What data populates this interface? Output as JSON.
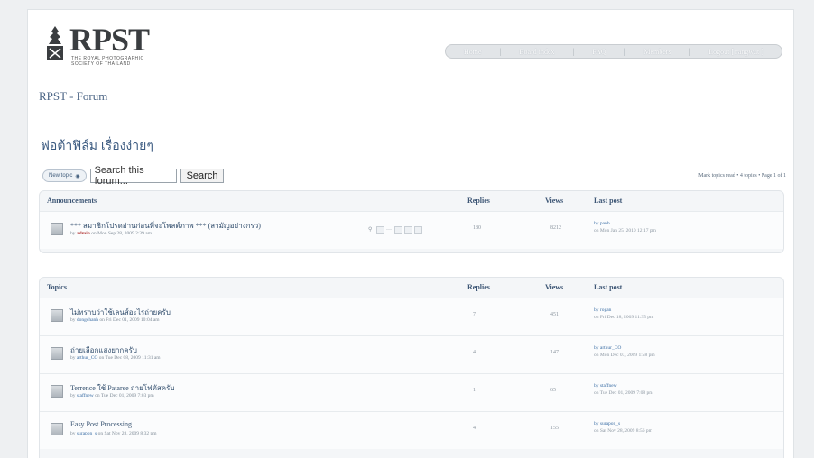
{
  "header": {
    "logo_word": "RPST",
    "logo_sub1": "THE ROYAL PHOTOGRAPHIC",
    "logo_sub2": "SOCIETY OF THAILAND",
    "site_title": "RPST - Forum"
  },
  "nav": {
    "items": [
      {
        "label": "Home"
      },
      {
        "label": "Board index"
      },
      {
        "label": "FAQ"
      },
      {
        "label": "Members"
      },
      {
        "label": "Logout [ rangwut ]"
      }
    ]
  },
  "forum": {
    "title": "ฟอต้าฟิล์ม เรื่องง่ายๆ"
  },
  "actions": {
    "new_topic": "New topic",
    "search_placeholder": "Search this forum...",
    "search_button": "Search",
    "pagination": "Mark topics read • 4 topics • Page 1 of 1"
  },
  "announcements": {
    "headers": {
      "title": "Announcements",
      "replies": "Replies",
      "views": "Views",
      "last_post": "Last post"
    },
    "rows": [
      {
        "title": "*** สมาชิกโปรดอ่านก่อนที่จะโพสต์ภาพ *** (สามัญอย่างกรว)",
        "meta_prefix": "by",
        "author": "admin",
        "meta_date": "on Mon Sep 28, 2009 2:39 am",
        "replies": "180",
        "views": "8212",
        "last_by": "by panb",
        "last_date": "on Mon Jan 25, 2010 12:17 pm"
      }
    ]
  },
  "topics": {
    "headers": {
      "title": "Topics",
      "replies": "Replies",
      "views": "Views",
      "last_post": "Last post"
    },
    "rows": [
      {
        "title": "ไม่ทราบว่าใช้เลนส์อะไรถ่ายครับ",
        "meta_prefix": "by",
        "author": "dongchanh",
        "meta_date": "on Fri Dec 01, 2009 10:04 am",
        "replies": "7",
        "views": "451",
        "last_by": "by rogan",
        "last_date": "on Fri Dec 18, 2009 11:35 pm"
      },
      {
        "title": "ถ่ายเลือกแสงยากครับ",
        "meta_prefix": "by",
        "author": "arthur_CO",
        "meta_date": "on Tue Dec 08, 2009 11:31 am",
        "replies": "4",
        "views": "147",
        "last_by": "by arthur_CO",
        "last_date": "on Mon Dec 07, 2009 1:58 pm"
      },
      {
        "title": "Terrence ใช้ Pataree ถ่ายโฟตัสครับ",
        "meta_prefix": "by",
        "author": "staffnew",
        "meta_date": "on Tue Dec 01, 2009 7:03 pm",
        "replies": "1",
        "views": "65",
        "last_by": "by staffnew",
        "last_date": "on Tue Dec 01, 2009 7:08 pm"
      },
      {
        "title": "Easy Post Processing",
        "meta_prefix": "by",
        "author": "surapon_s",
        "meta_date": "on Sat Nov 28, 2009 8:32 pm",
        "replies": "4",
        "views": "155",
        "last_by": "by surapon_s",
        "last_date": "on Sat Nov 28, 2009 8:56 pm"
      }
    ]
  },
  "colors": {
    "link": "#3b5a80",
    "author_red": "#b23a3a",
    "panel_bg": "#f4f6f8"
  }
}
